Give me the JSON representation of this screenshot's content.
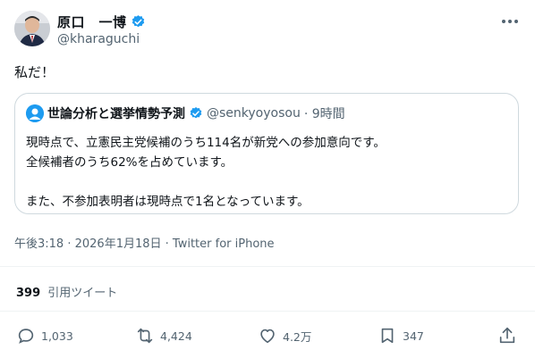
{
  "author": {
    "name": "原口　一博",
    "handle": "@kharaguchi"
  },
  "tweet": {
    "text": "私だ！"
  },
  "quoted": {
    "name": "世論分析と選挙情勢予測",
    "handle": "@senkyoyosou",
    "time": "· 9時間",
    "lines": [
      "現時点で、立憲民主党候補のうち114名が新党への参加意向です。",
      "全候補者のうち62%を占めています。",
      "",
      "また、不参加表明者は現時点で1名となっています。"
    ]
  },
  "meta": {
    "time": "午後3:18",
    "date": "2026年1月18日",
    "source": "Twitter for iPhone"
  },
  "quote_tweets": {
    "count": "399",
    "label": "引用ツイート"
  },
  "actions": {
    "reply": "1,033",
    "retweet": "4,424",
    "like": "4.2万",
    "bookmark": "347"
  },
  "colors": {
    "verified": "#1d9bf0",
    "secondary_text": "#536471",
    "border": "#cfd9de"
  },
  "icons": [
    "verified-badge-icon",
    "more-icon",
    "reply-icon",
    "retweet-icon",
    "like-icon",
    "bookmark-icon",
    "share-icon"
  ]
}
